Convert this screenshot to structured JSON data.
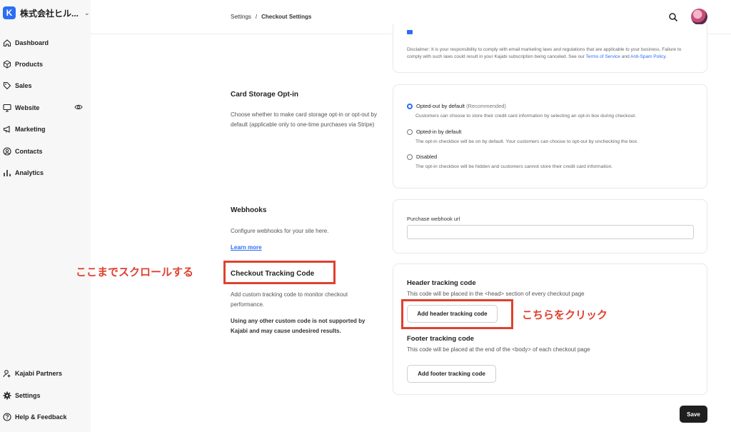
{
  "brand": {
    "name": "株式会社ヒル...",
    "logo_letter": "K"
  },
  "sidebar": {
    "items": [
      {
        "label": "Dashboard",
        "icon": "home-icon"
      },
      {
        "label": "Products",
        "icon": "cube-icon"
      },
      {
        "label": "Sales",
        "icon": "tag-icon"
      },
      {
        "label": "Website",
        "icon": "monitor-icon"
      },
      {
        "label": "Marketing",
        "icon": "megaphone-icon"
      },
      {
        "label": "Contacts",
        "icon": "contact-icon"
      },
      {
        "label": "Analytics",
        "icon": "bar-chart-icon"
      }
    ],
    "bottom_items": [
      {
        "label": "Kajabi Partners",
        "icon": "partners-icon"
      },
      {
        "label": "Settings",
        "icon": "gear-icon"
      },
      {
        "label": "Help & Feedback",
        "icon": "help-icon"
      }
    ]
  },
  "header": {
    "breadcrumb_root": "Settings",
    "breadcrumb_sep": "/",
    "breadcrumb_current": "Checkout Settings"
  },
  "disclaimer": {
    "text1": "Disclaimer: It is your responsibility to comply with email marketing laws and regulations that are applicable to your business. Failure to comply with such laws could result in your Kajabi subscription being canceled. See our ",
    "terms": "Terms of Service",
    "and": " and ",
    "antispam": "Anti-Spam Policy",
    "end": "."
  },
  "card_storage": {
    "title": "Card Storage Opt-in",
    "desc": "Choose whether to make card storage opt-in or opt-out by default (applicable only to one-time purchases via Stripe)",
    "options": [
      {
        "label": "Opted-out by default",
        "extra": "(Recommended)",
        "help": "Customers can choose to store their credit card information by selecting an opt-in box during checkout."
      },
      {
        "label": "Opted-in by default",
        "extra": "",
        "help": "The opt-in checkbox will be on by default. Your customers can choose to opt-out by unchecking the box."
      },
      {
        "label": "Disabled",
        "extra": "",
        "help": "The opt-in checkbox will be hidden and customers cannot store their credit card information."
      }
    ]
  },
  "webhooks": {
    "title": "Webhooks",
    "desc": "Configure webhooks for your site here.",
    "learn_more": "Learn more",
    "field_label": "Purchase webhook url",
    "field_value": ""
  },
  "tracking": {
    "title": "Checkout Tracking Code",
    "desc": "Add custom tracking code to monitor checkout performance.",
    "warning": "Using any other custom code is not supported by Kajabi and may cause undesired results.",
    "header_title": "Header tracking code",
    "header_desc": "This code will be placed in the <head> section of every checkout page",
    "header_button": "Add header tracking code",
    "footer_title": "Footer tracking code",
    "footer_desc": "This code will be placed at the end of the <body> of each checkout page",
    "footer_button": "Add footer tracking code"
  },
  "annotations": {
    "scroll": "ここまでスクロールする",
    "click": "こちらをクリック",
    "color": "#e0402f"
  },
  "footer": {
    "save_label": "Save"
  },
  "colors": {
    "accent": "#2b6ef5",
    "sidebar_bg": "#f7f7f7"
  }
}
